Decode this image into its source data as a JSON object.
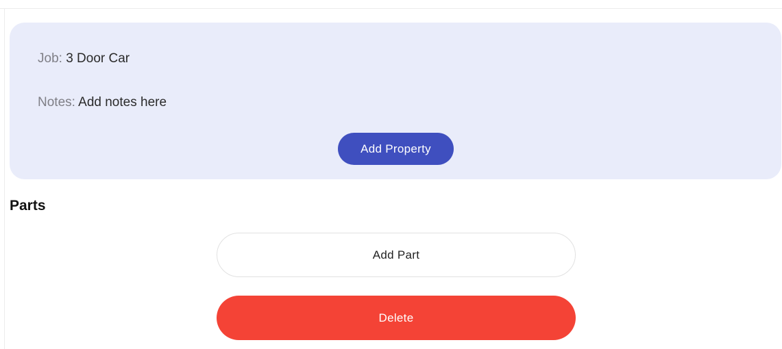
{
  "job_card": {
    "job": {
      "label": "Job:",
      "value": "3 Door Car"
    },
    "notes": {
      "label": "Notes:",
      "value": "Add notes here"
    },
    "add_property_label": "Add Property",
    "background_color": "#e9ecfa",
    "accent_color": "#3f4fbf"
  },
  "parts": {
    "title": "Parts",
    "add_part_label": "Add Part",
    "delete_label": "Delete",
    "delete_color": "#f44336"
  }
}
